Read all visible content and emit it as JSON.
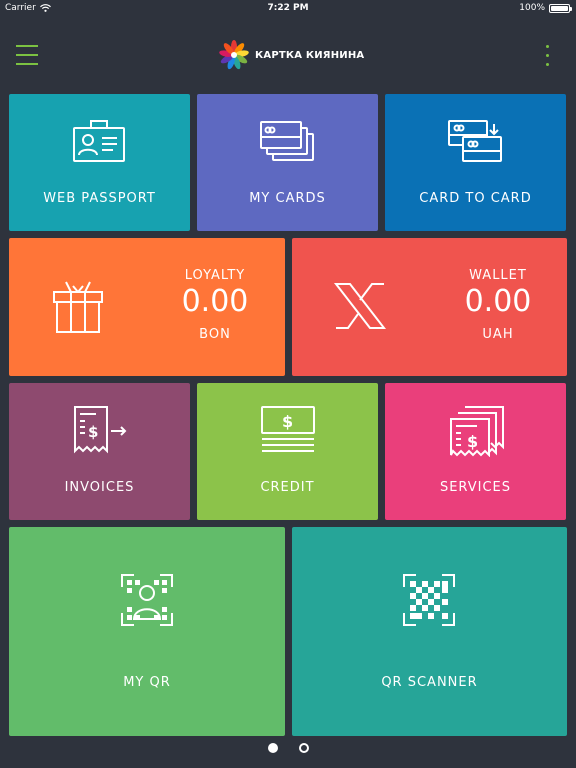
{
  "status_bar": {
    "carrier": "Carrier",
    "time": "7:22 PM",
    "battery": "100%"
  },
  "header": {
    "title": "КАРТКА КИЯНИНА"
  },
  "tiles": {
    "web_passport": {
      "label": "WEB PASSPORT",
      "color": "#17a2b0",
      "icon": "id-card-icon"
    },
    "my_cards": {
      "label": "MY CARDS",
      "color": "#5e69c1",
      "icon": "cards-stack-icon"
    },
    "card_to_card": {
      "label": "CARD TO CARD",
      "color": "#0a71b5",
      "icon": "card-transfer-icon"
    },
    "loyalty": {
      "title": "LOYALTY",
      "value": "0.00",
      "unit": "BON",
      "color": "#ff7538",
      "icon": "gift-icon"
    },
    "wallet": {
      "title": "WALLET",
      "value": "0.00",
      "unit": "UAH",
      "color": "#f0544e",
      "icon": "x-logo-icon"
    },
    "invoices": {
      "label": "INVOICES",
      "color": "#8e4a6f",
      "icon": "invoice-icon"
    },
    "credit": {
      "label": "CREDIT",
      "color": "#8cc34a",
      "icon": "credit-icon"
    },
    "services": {
      "label": "SERVICES",
      "color": "#ea3f7b",
      "icon": "services-receipt-icon"
    },
    "my_qr": {
      "label": "MY QR",
      "color": "#62bc6a",
      "icon": "qr-person-icon"
    },
    "qr_scanner": {
      "label": "QR SCANNER",
      "color": "#26a598",
      "icon": "qr-scan-icon"
    }
  },
  "pager": {
    "pages": 2,
    "current": 1
  }
}
